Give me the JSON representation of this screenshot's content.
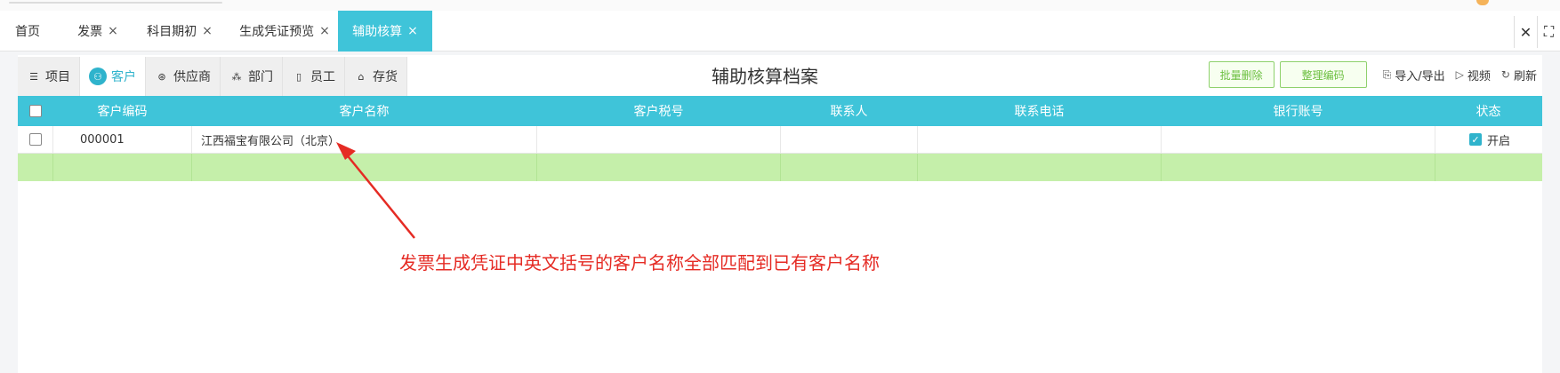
{
  "tabs": [
    {
      "label": "首页",
      "closable": false
    },
    {
      "label": "发票",
      "closable": true
    },
    {
      "label": "科目期初",
      "closable": true
    },
    {
      "label": "生成凭证预览",
      "closable": true
    },
    {
      "label": "辅助核算",
      "closable": true,
      "active": true
    }
  ],
  "tab_close_glyph": "×",
  "segment_tabs": [
    {
      "label": "项目",
      "icon": "list-icon"
    },
    {
      "label": "客户",
      "icon": "user-icon",
      "active": true
    },
    {
      "label": "供应商",
      "icon": "supplier-icon"
    },
    {
      "label": "部门",
      "icon": "department-icon"
    },
    {
      "label": "员工",
      "icon": "employee-icon"
    },
    {
      "label": "存货",
      "icon": "inventory-icon"
    }
  ],
  "page_title": "辅助核算档案",
  "actions": {
    "batch_delete": "批量删除",
    "tidy_code": "整理编码",
    "import_export": "导入/导出",
    "video": "视频",
    "refresh": "刷新"
  },
  "columns": [
    "客户编码",
    "客户名称",
    "客户税号",
    "联系人",
    "联系电话",
    "银行账号",
    "状态"
  ],
  "rows": [
    {
      "code": "000001",
      "name": "江西福宝有限公司（北京）",
      "tax_no": "",
      "contact": "",
      "phone": "",
      "bank": "",
      "status": "开启",
      "enabled": true
    }
  ],
  "annotation": "发票生成凭证中英文括号的客户名称全部匹配到已有客户名称",
  "colors": {
    "accent": "#3fc4d9",
    "green_row": "#c5efaa",
    "annotation": "#e52b24",
    "button_green": "#6bbf3f"
  }
}
